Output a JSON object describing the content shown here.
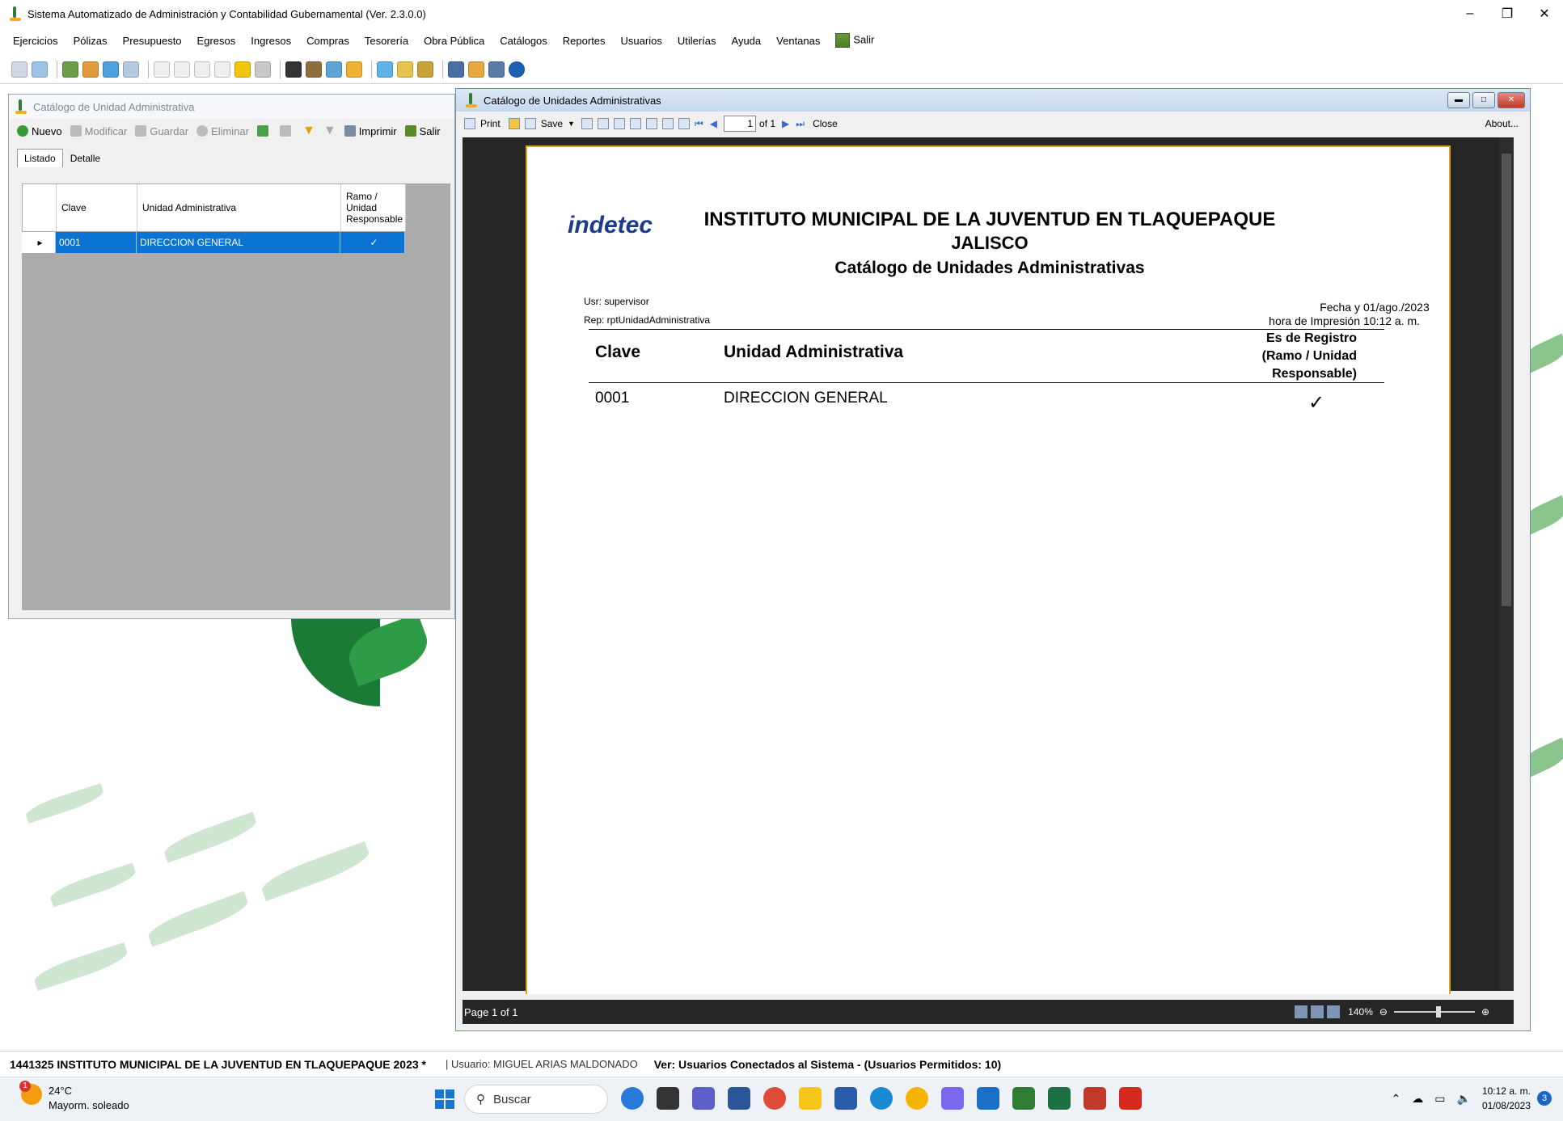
{
  "window": {
    "title": "Sistema Automatizado de Administración y Contabilidad Gubernamental  (Ver. 2.3.0.0)",
    "minimize": "–",
    "restore": "❐",
    "close": "✕"
  },
  "menu": [
    "Ejercicios",
    "Pólizas",
    "Presupuesto",
    "Egresos",
    "Ingresos",
    "Compras",
    "Tesorería",
    "Obra Pública",
    "Catálogos",
    "Reportes",
    "Usuarios",
    "Utilerías",
    "Ayuda",
    "Ventanas"
  ],
  "menu_salir": "Salir",
  "catalog_window": {
    "title": "Catálogo de Unidad Administrativa",
    "toolbar": {
      "nuevo": "Nuevo",
      "modificar": "Modificar",
      "guardar": "Guardar",
      "eliminar": "Eliminar",
      "imprimir": "Imprimir",
      "salir": "Salir"
    },
    "tabs": [
      "Listado",
      "Detalle"
    ],
    "columns": [
      "Clave",
      "Unidad Administrativa",
      "Ramo / Unidad Responsable"
    ],
    "rows": [
      {
        "clave": "0001",
        "unidad": "DIRECCION GENERAL",
        "ramo": "✓"
      }
    ]
  },
  "report_window": {
    "title": "Catálogo de Unidades Administrativas",
    "toolbar": {
      "print": "Print",
      "save": "Save",
      "page_value": "1",
      "of_label": "of 1",
      "close": "Close",
      "about": "About..."
    },
    "report": {
      "logo": "indetec",
      "heading1": "INSTITUTO MUNICIPAL DE LA JUVENTUD EN TLAQUEPAQUE",
      "heading2": "JALISCO",
      "heading3": "Catálogo de Unidades Administrativas",
      "usr": "Usr: supervisor",
      "rep": "Rep: rptUnidadAdministrativa",
      "fecha_label": "Fecha y",
      "fecha_value": "01/ago./2023",
      "hora_label": "hora de Impresión",
      "hora_value": "10:12 a. m.",
      "col_clave": "Clave",
      "col_unidad": "Unidad Administrativa",
      "col_registro": "Es de Registro (Ramo / Unidad Responsable)",
      "rows": [
        {
          "clave": "0001",
          "unidad": "DIRECCION GENERAL",
          "registro": "✓"
        }
      ]
    },
    "status": "Page 1 of 1",
    "zoom": "140%"
  },
  "app_status": {
    "org": "1441325 INSTITUTO MUNICIPAL DE LA JUVENTUD EN TLAQUEPAQUE  2023   *",
    "user": "| Usuario: MIGUEL ARIAS MALDONADO",
    "connected": "Ver: Usuarios Conectados al Sistema - (Usuarios Permitidos: 10)"
  },
  "taskbar": {
    "temp": "24°C",
    "weather": "Mayorm. soleado",
    "weather_badge": "1",
    "search_placeholder": "Buscar",
    "time": "10:12 a. m.",
    "date": "01/08/2023",
    "notifications": "3"
  }
}
